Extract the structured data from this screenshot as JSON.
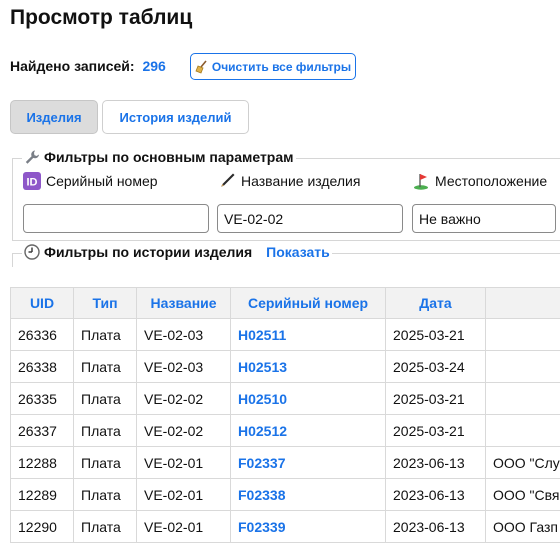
{
  "page_title": "Просмотр таблиц",
  "found": {
    "label": "Найдено записей:",
    "count": "296"
  },
  "clear_button": {
    "icon": "broom-icon",
    "label": "Очистить все фильтры"
  },
  "tabs": [
    {
      "label": "Изделия",
      "active": true
    },
    {
      "label": "История изделий",
      "active": false
    }
  ],
  "main_filters": {
    "legend": "Фильтры по основным параметрам",
    "legend_icon": "wrench-icon",
    "fields": [
      {
        "label": "Серийный номер",
        "icon": "id-badge-icon",
        "value": ""
      },
      {
        "label": "Название изделия",
        "icon": "pen-icon",
        "value": "VE-02-02"
      },
      {
        "label": "Местоположение",
        "icon": "golf-flag-icon",
        "value": "Не важно"
      }
    ]
  },
  "history_filters": {
    "legend": "Фильтры по истории изделия",
    "legend_icon": "clock-icon",
    "toggle": "Показать"
  },
  "table": {
    "columns": [
      "UID",
      "Тип",
      "Название",
      "Серийный номер",
      "Дата",
      ""
    ],
    "rows": [
      [
        "26336",
        "Плата",
        "VE-02-03",
        "H02511",
        "2025-03-21",
        ""
      ],
      [
        "26338",
        "Плата",
        "VE-02-03",
        "H02513",
        "2025-03-24",
        ""
      ],
      [
        "26335",
        "Плата",
        "VE-02-02",
        "H02510",
        "2025-03-21",
        ""
      ],
      [
        "26337",
        "Плата",
        "VE-02-02",
        "H02512",
        "2025-03-21",
        ""
      ],
      [
        "12288",
        "Плата",
        "VE-02-01",
        "F02337",
        "2023-06-13",
        "ООО \"Слу"
      ],
      [
        "12289",
        "Плата",
        "VE-02-01",
        "F02338",
        "2023-06-13",
        "ООО \"Свя"
      ],
      [
        "12290",
        "Плата",
        "VE-02-01",
        "F02339",
        "2023-06-13",
        "ООО Газп"
      ]
    ]
  },
  "colors": {
    "accent": "#1a73e8",
    "header_bg": "#f2f2f2",
    "active_tab_bg": "#dcdcdc",
    "border": "#d9d9d9"
  }
}
